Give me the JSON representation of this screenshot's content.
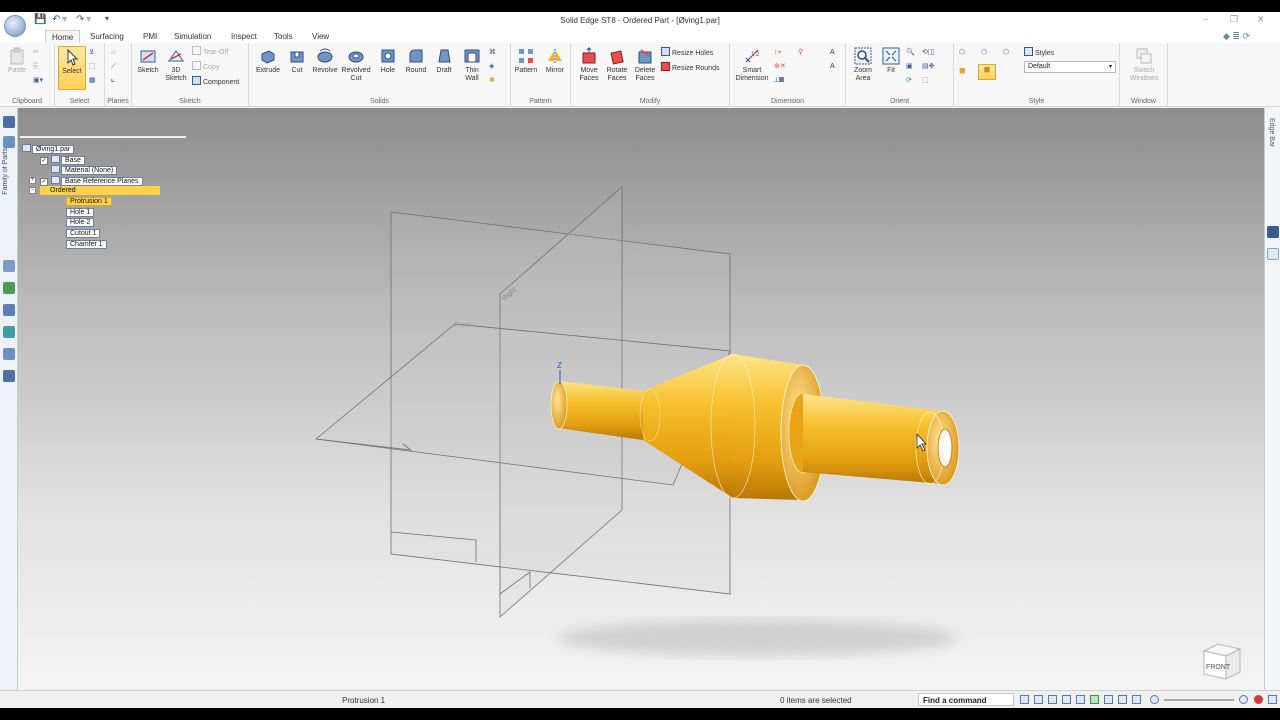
{
  "window": {
    "title": "Solid Edge ST8 - Ordered Part - [Øving1.par]",
    "minimize_glyph": "–",
    "restore_glyph": "❐",
    "close_glyph": "✕"
  },
  "tabs": [
    "Home",
    "Surfacing",
    "PMI",
    "Simulation",
    "Inspect",
    "Tools",
    "View"
  ],
  "ribbon": {
    "clipboard": {
      "label": "Clipboard",
      "paste": "Paste"
    },
    "select": {
      "label": "Select",
      "select": "Select"
    },
    "planes": {
      "label": "Planes"
    },
    "sketch": {
      "label": "Sketch",
      "sketch": "Sketch",
      "sketch3d_line1": "3D",
      "sketch3d_line2": "Sketch",
      "tearoff": "Tear-Off",
      "copy": "Copy",
      "component": "Component"
    },
    "solids": {
      "label": "Solids",
      "extrude": "Extrude",
      "cut": "Cut",
      "revolve": "Revolve",
      "revolved_cut_line1": "Revolved",
      "revolved_cut_line2": "Cut",
      "hole": "Hole",
      "round": "Round",
      "draft": "Draft",
      "thinwall_line1": "Thin",
      "thinwall_line2": "Wall"
    },
    "pattern": {
      "label": "Pattern",
      "pattern": "Pattern",
      "mirror": "Mirror"
    },
    "modify": {
      "label": "Modify",
      "move_line1": "Move",
      "move_line2": "Faces",
      "rotate_line1": "Rotate",
      "rotate_line2": "Faces",
      "delete_line1": "Delete",
      "delete_line2": "Faces",
      "resize_holes": "Resize Holes",
      "resize_rounds": "Resize Rounds"
    },
    "dimension": {
      "label": "Dimension",
      "smart_line1": "Smart",
      "smart_line2": "Dimension"
    },
    "orient": {
      "label": "Orient",
      "zoom_line1": "Zoom",
      "zoom_line2": "Area",
      "fit": "Fit"
    },
    "style": {
      "label": "Style",
      "styles": "Styles",
      "default_value": "Default"
    },
    "window": {
      "label": "Window",
      "switch_line1": "Switch",
      "switch_line2": "Windows"
    }
  },
  "left_panel": {
    "tab_label": "Family of Parts"
  },
  "right_panel": {
    "tab_label": "Edge Bar"
  },
  "tree": {
    "root": "Øving1.par",
    "items": [
      {
        "label": "Base"
      },
      {
        "label": "Material (None)"
      },
      {
        "label": "Base Reference Planes"
      },
      {
        "label": "Ordered"
      },
      {
        "label": "Protrusion 1"
      },
      {
        "label": "Hole 1"
      },
      {
        "label": "Hole 2"
      },
      {
        "label": "Cutout 1"
      },
      {
        "label": "Chamfer 1"
      }
    ]
  },
  "viewport": {
    "axis_label": "Z",
    "plane_labels": [
      "Right",
      "Front"
    ],
    "view_cube_label": "FRONT"
  },
  "status": {
    "prompt": "Protrusion 1",
    "selection": "0 items are selected",
    "find_command": "Find a command"
  },
  "colors": {
    "part_gold": "#f2b320",
    "highlight_yellow": "#ffd24a",
    "accent_blue": "#3a5a8c"
  }
}
